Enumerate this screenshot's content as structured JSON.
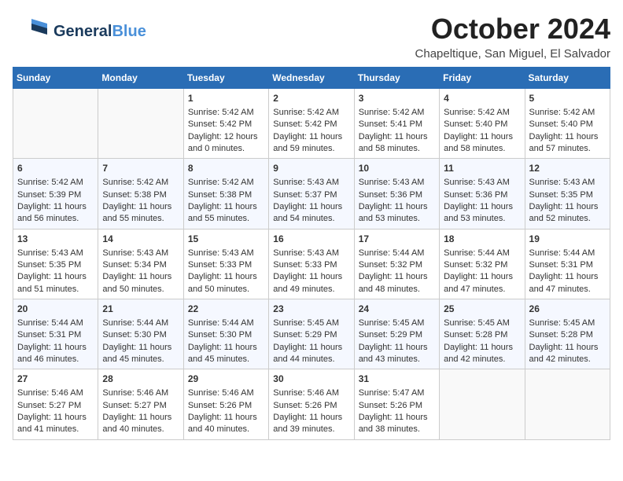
{
  "header": {
    "logo_general": "General",
    "logo_blue": "Blue",
    "month_year": "October 2024",
    "location": "Chapeltique, San Miguel, El Salvador"
  },
  "days_of_week": [
    "Sunday",
    "Monday",
    "Tuesday",
    "Wednesday",
    "Thursday",
    "Friday",
    "Saturday"
  ],
  "weeks": [
    [
      {
        "day": "",
        "sunrise": "",
        "sunset": "",
        "daylight": ""
      },
      {
        "day": "",
        "sunrise": "",
        "sunset": "",
        "daylight": ""
      },
      {
        "day": "1",
        "sunrise": "Sunrise: 5:42 AM",
        "sunset": "Sunset: 5:42 PM",
        "daylight": "Daylight: 12 hours and 0 minutes."
      },
      {
        "day": "2",
        "sunrise": "Sunrise: 5:42 AM",
        "sunset": "Sunset: 5:42 PM",
        "daylight": "Daylight: 11 hours and 59 minutes."
      },
      {
        "day": "3",
        "sunrise": "Sunrise: 5:42 AM",
        "sunset": "Sunset: 5:41 PM",
        "daylight": "Daylight: 11 hours and 58 minutes."
      },
      {
        "day": "4",
        "sunrise": "Sunrise: 5:42 AM",
        "sunset": "Sunset: 5:40 PM",
        "daylight": "Daylight: 11 hours and 58 minutes."
      },
      {
        "day": "5",
        "sunrise": "Sunrise: 5:42 AM",
        "sunset": "Sunset: 5:40 PM",
        "daylight": "Daylight: 11 hours and 57 minutes."
      }
    ],
    [
      {
        "day": "6",
        "sunrise": "Sunrise: 5:42 AM",
        "sunset": "Sunset: 5:39 PM",
        "daylight": "Daylight: 11 hours and 56 minutes."
      },
      {
        "day": "7",
        "sunrise": "Sunrise: 5:42 AM",
        "sunset": "Sunset: 5:38 PM",
        "daylight": "Daylight: 11 hours and 55 minutes."
      },
      {
        "day": "8",
        "sunrise": "Sunrise: 5:42 AM",
        "sunset": "Sunset: 5:38 PM",
        "daylight": "Daylight: 11 hours and 55 minutes."
      },
      {
        "day": "9",
        "sunrise": "Sunrise: 5:43 AM",
        "sunset": "Sunset: 5:37 PM",
        "daylight": "Daylight: 11 hours and 54 minutes."
      },
      {
        "day": "10",
        "sunrise": "Sunrise: 5:43 AM",
        "sunset": "Sunset: 5:36 PM",
        "daylight": "Daylight: 11 hours and 53 minutes."
      },
      {
        "day": "11",
        "sunrise": "Sunrise: 5:43 AM",
        "sunset": "Sunset: 5:36 PM",
        "daylight": "Daylight: 11 hours and 53 minutes."
      },
      {
        "day": "12",
        "sunrise": "Sunrise: 5:43 AM",
        "sunset": "Sunset: 5:35 PM",
        "daylight": "Daylight: 11 hours and 52 minutes."
      }
    ],
    [
      {
        "day": "13",
        "sunrise": "Sunrise: 5:43 AM",
        "sunset": "Sunset: 5:35 PM",
        "daylight": "Daylight: 11 hours and 51 minutes."
      },
      {
        "day": "14",
        "sunrise": "Sunrise: 5:43 AM",
        "sunset": "Sunset: 5:34 PM",
        "daylight": "Daylight: 11 hours and 50 minutes."
      },
      {
        "day": "15",
        "sunrise": "Sunrise: 5:43 AM",
        "sunset": "Sunset: 5:33 PM",
        "daylight": "Daylight: 11 hours and 50 minutes."
      },
      {
        "day": "16",
        "sunrise": "Sunrise: 5:43 AM",
        "sunset": "Sunset: 5:33 PM",
        "daylight": "Daylight: 11 hours and 49 minutes."
      },
      {
        "day": "17",
        "sunrise": "Sunrise: 5:44 AM",
        "sunset": "Sunset: 5:32 PM",
        "daylight": "Daylight: 11 hours and 48 minutes."
      },
      {
        "day": "18",
        "sunrise": "Sunrise: 5:44 AM",
        "sunset": "Sunset: 5:32 PM",
        "daylight": "Daylight: 11 hours and 47 minutes."
      },
      {
        "day": "19",
        "sunrise": "Sunrise: 5:44 AM",
        "sunset": "Sunset: 5:31 PM",
        "daylight": "Daylight: 11 hours and 47 minutes."
      }
    ],
    [
      {
        "day": "20",
        "sunrise": "Sunrise: 5:44 AM",
        "sunset": "Sunset: 5:31 PM",
        "daylight": "Daylight: 11 hours and 46 minutes."
      },
      {
        "day": "21",
        "sunrise": "Sunrise: 5:44 AM",
        "sunset": "Sunset: 5:30 PM",
        "daylight": "Daylight: 11 hours and 45 minutes."
      },
      {
        "day": "22",
        "sunrise": "Sunrise: 5:44 AM",
        "sunset": "Sunset: 5:30 PM",
        "daylight": "Daylight: 11 hours and 45 minutes."
      },
      {
        "day": "23",
        "sunrise": "Sunrise: 5:45 AM",
        "sunset": "Sunset: 5:29 PM",
        "daylight": "Daylight: 11 hours and 44 minutes."
      },
      {
        "day": "24",
        "sunrise": "Sunrise: 5:45 AM",
        "sunset": "Sunset: 5:29 PM",
        "daylight": "Daylight: 11 hours and 43 minutes."
      },
      {
        "day": "25",
        "sunrise": "Sunrise: 5:45 AM",
        "sunset": "Sunset: 5:28 PM",
        "daylight": "Daylight: 11 hours and 42 minutes."
      },
      {
        "day": "26",
        "sunrise": "Sunrise: 5:45 AM",
        "sunset": "Sunset: 5:28 PM",
        "daylight": "Daylight: 11 hours and 42 minutes."
      }
    ],
    [
      {
        "day": "27",
        "sunrise": "Sunrise: 5:46 AM",
        "sunset": "Sunset: 5:27 PM",
        "daylight": "Daylight: 11 hours and 41 minutes."
      },
      {
        "day": "28",
        "sunrise": "Sunrise: 5:46 AM",
        "sunset": "Sunset: 5:27 PM",
        "daylight": "Daylight: 11 hours and 40 minutes."
      },
      {
        "day": "29",
        "sunrise": "Sunrise: 5:46 AM",
        "sunset": "Sunset: 5:26 PM",
        "daylight": "Daylight: 11 hours and 40 minutes."
      },
      {
        "day": "30",
        "sunrise": "Sunrise: 5:46 AM",
        "sunset": "Sunset: 5:26 PM",
        "daylight": "Daylight: 11 hours and 39 minutes."
      },
      {
        "day": "31",
        "sunrise": "Sunrise: 5:47 AM",
        "sunset": "Sunset: 5:26 PM",
        "daylight": "Daylight: 11 hours and 38 minutes."
      },
      {
        "day": "",
        "sunrise": "",
        "sunset": "",
        "daylight": ""
      },
      {
        "day": "",
        "sunrise": "",
        "sunset": "",
        "daylight": ""
      }
    ]
  ]
}
